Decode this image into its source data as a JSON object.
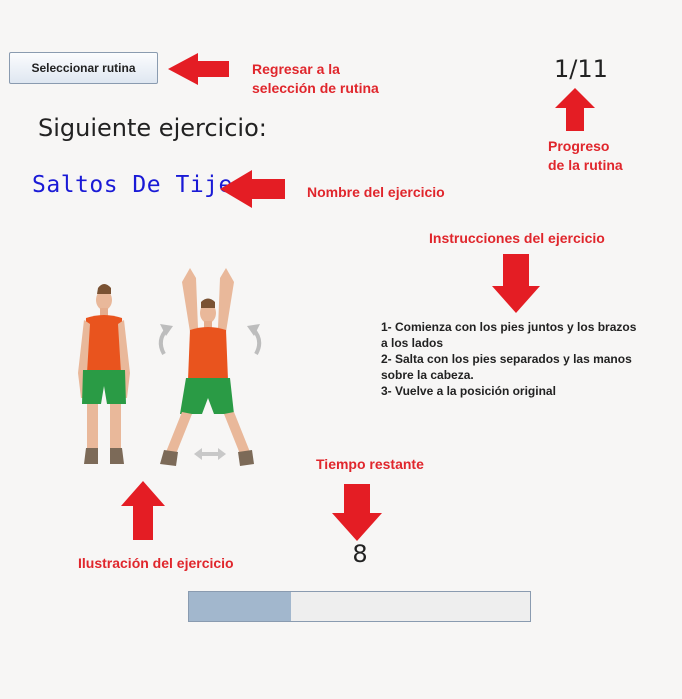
{
  "header": {
    "back_button_label": "Seleccionar rutina",
    "progress_label": "1/11"
  },
  "exercise": {
    "next_label": "Siguiente ejercicio:",
    "name": "Saltos De Tijera",
    "instructions": [
      "1- Comienza con los pies juntos y los brazos a los lados",
      "2- Salta con los pies separados y las manos sobre la cabeza.",
      "3- Vuelve a la posición original"
    ]
  },
  "timer": {
    "remaining": "8",
    "progress_fraction": 0.3
  },
  "annotations": {
    "back_line1": "Regresar a la",
    "back_line2": "selección de rutina",
    "progress_line1": "Progreso",
    "progress_line2": "de la rutina",
    "name": "Nombre del ejercicio",
    "instructions": "Instrucciones del ejercicio",
    "time": "Tiempo restante",
    "illustration": "Ilustración del ejercicio"
  },
  "colors": {
    "annotation": "#e0262c",
    "exercise_name": "#1a1ad6",
    "bar_fill": "#a2b7cd"
  }
}
